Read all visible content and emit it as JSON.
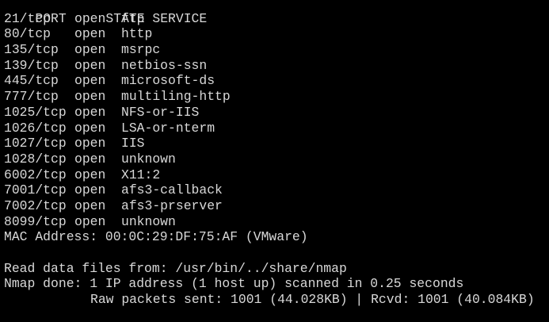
{
  "header": {
    "port": "PORT",
    "state": "STATE",
    "service": "SERVICE"
  },
  "ports": [
    {
      "port": "21/tcp",
      "state": "open",
      "service": "ftp"
    },
    {
      "port": "80/tcp",
      "state": "open",
      "service": "http"
    },
    {
      "port": "135/tcp",
      "state": "open",
      "service": "msrpc"
    },
    {
      "port": "139/tcp",
      "state": "open",
      "service": "netbios-ssn"
    },
    {
      "port": "445/tcp",
      "state": "open",
      "service": "microsoft-ds"
    },
    {
      "port": "777/tcp",
      "state": "open",
      "service": "multiling-http"
    },
    {
      "port": "1025/tcp",
      "state": "open",
      "service": "NFS-or-IIS"
    },
    {
      "port": "1026/tcp",
      "state": "open",
      "service": "LSA-or-nterm"
    },
    {
      "port": "1027/tcp",
      "state": "open",
      "service": "IIS"
    },
    {
      "port": "1028/tcp",
      "state": "open",
      "service": "unknown"
    },
    {
      "port": "6002/tcp",
      "state": "open",
      "service": "X11:2"
    },
    {
      "port": "7001/tcp",
      "state": "open",
      "service": "afs3-callback"
    },
    {
      "port": "7002/tcp",
      "state": "open",
      "service": "afs3-prserver"
    },
    {
      "port": "8099/tcp",
      "state": "open",
      "service": "unknown"
    }
  ],
  "mac_line": "MAC Address: 00:0C:29:DF:75:AF (VMware)",
  "read_data_line": "Read data files from: /usr/bin/../share/nmap",
  "done_line": "Nmap done: 1 IP address (1 host up) scanned in 0.25 seconds",
  "packets_line": "Raw packets sent: 1001 (44.028KB) | Rcvd: 1001 (40.084KB)",
  "colors": {
    "background": "#000000",
    "text": "#d8d8d8"
  }
}
